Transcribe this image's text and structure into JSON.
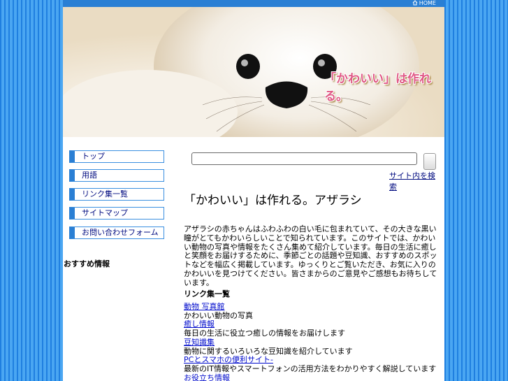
{
  "header": {
    "home_label": "HOME"
  },
  "banner": {
    "tagline": "「かわいい」は作れる。"
  },
  "sidebar": {
    "items": [
      {
        "label": "トップ"
      },
      {
        "label": "用語"
      },
      {
        "label": "リンク集一覧"
      },
      {
        "label": "サイトマップ"
      },
      {
        "label": "お問い合わせフォーム"
      }
    ],
    "section_title": "おすすめ情報"
  },
  "search": {
    "placeholder": "",
    "button_label": "",
    "link_label": "サイト内を検索"
  },
  "main": {
    "title": "「かわいい」は作れる。アザラシ",
    "intro": "アザラシの赤ちゃんはふわふわの白い毛に包まれていて、その大きな黒い瞳がとてもかわいらしいことで知られています。このサイトでは、かわいい動物の写真や情報をたくさん集めて紹介しています。毎日の生活に癒しと笑顔をお届けするために、季節ごとの話題や豆知識、おすすめのスポットなどを幅広く掲載しています。ゆっくりとご覧いただき、お気に入りのかわいいを見つけてください。皆さまからのご意見やご感想もお待ちしています。",
    "section_title": "リンク集一覧",
    "entries": [
      {
        "link": "動物 写真館",
        "desc": "かわいい動物の写真"
      },
      {
        "link": "癒し情報",
        "desc": "毎日の生活に役立つ癒しの情報をお届けします"
      },
      {
        "link": "豆知識集",
        "desc": "動物に関するいろいろな豆知識を紹介しています"
      },
      {
        "link": "PCとスマホの便利サイト-",
        "desc": "最新のIT情報やスマートフォンの活用方法をわかりやすく解説しています"
      },
      {
        "link": "お役立ち情報",
        "desc": ""
      }
    ]
  },
  "colors": {
    "background": "#2f8fe6",
    "accent": "#2a7fd4",
    "link": "#000bcc"
  }
}
